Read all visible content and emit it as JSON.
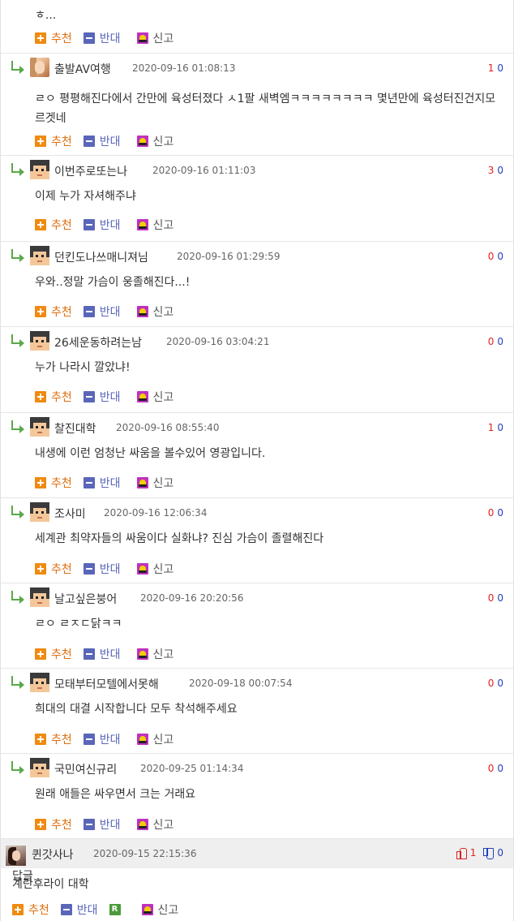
{
  "actions": {
    "upvote": "추천",
    "downvote": "반대",
    "report": "신고",
    "reply": "답글"
  },
  "top_fragment": "ㅎ...",
  "replies": [
    {
      "nickname": "출발AV여행",
      "date": "2020-09-16 01:08:13",
      "up": "1",
      "down": "0",
      "avatar": "photo-avatar",
      "text": "ㄹㅇ 평평해진다에서 간만에 육성터졌다 ㅅ1팔 새벽엠ㅋㅋㅋㅋㅋㅋㅋㅋ 몇년만에 육성터진건지모르겟네"
    },
    {
      "nickname": "이번주로또는나",
      "date": "2020-09-16 01:11:03",
      "up": "3",
      "down": "0",
      "avatar": "pixel-avatar",
      "text": "이제 누가 자셔해주냐"
    },
    {
      "nickname": "던킨도나쓰매니져님",
      "date": "2020-09-16 01:29:59",
      "up": "0",
      "down": "0",
      "avatar": "pixel-avatar",
      "text": "우와..정말 가슴이 웅졸해진다...!"
    },
    {
      "nickname": "26세운동하려는남",
      "date": "2020-09-16 03:04:21",
      "up": "0",
      "down": "0",
      "avatar": "pixel-avatar",
      "text": "누가 나라시 깔았냐!"
    },
    {
      "nickname": "찰진대학",
      "date": "2020-09-16 08:55:40",
      "up": "1",
      "down": "0",
      "avatar": "pixel-avatar",
      "text": "내생에 이런 엄청난 싸움을 볼수있어 영광입니다."
    },
    {
      "nickname": "조사미",
      "date": "2020-09-16 12:06:34",
      "up": "0",
      "down": "0",
      "avatar": "pixel-avatar",
      "text": "세계관 최약자들의 싸움이다 실화냐? 진심 가슴이 졸렬해진다"
    },
    {
      "nickname": "날고싶은붕어",
      "date": "2020-09-16 20:20:56",
      "up": "0",
      "down": "0",
      "avatar": "pixel-avatar",
      "text": "ㄹㅇ ㄹㅈㄷ닭ㅋㅋ"
    },
    {
      "nickname": "모태부터모텔에서못해",
      "date": "2020-09-18 00:07:54",
      "up": "0",
      "down": "0",
      "avatar": "pixel-avatar",
      "text": "희대의 대결 시작합니다 모두 착석해주세요"
    },
    {
      "nickname": "국민여신규리",
      "date": "2020-09-25 01:14:34",
      "up": "0",
      "down": "0",
      "avatar": "pixel-avatar",
      "text": "원래 애들은 싸우면서 크는 거래요"
    }
  ],
  "main_comment": {
    "nickname": "퀸갓사나",
    "date": "2020-09-15 22:15:36",
    "up": "1",
    "down": "0",
    "text": "계란후라이 대학"
  },
  "colors": {
    "upvote": "#f08a10",
    "downvote": "#5a66b8",
    "report": "#c030c0",
    "reply": "#4a9a3a",
    "vote_up_count": "#e02020",
    "vote_down_count": "#2040c0"
  }
}
